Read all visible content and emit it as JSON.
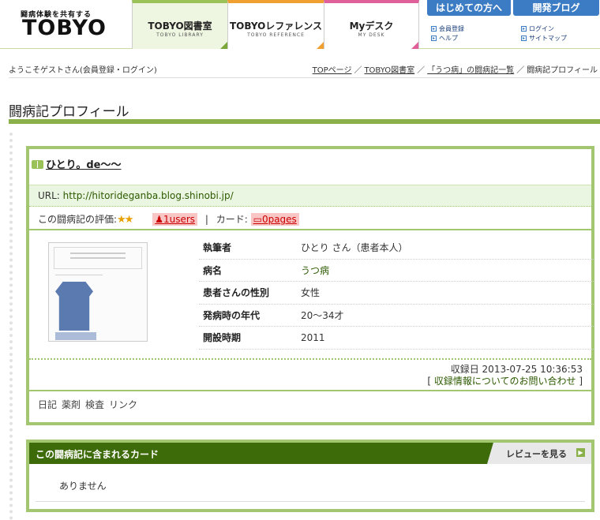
{
  "header": {
    "logo_tagline": "闘病体験を共有する",
    "logo_text": "TOBYO",
    "tabs": [
      {
        "label": "TOBYO図書室",
        "sublabel": "TOBYO LIBRARY"
      },
      {
        "label": "TOBYOレファレンス",
        "sublabel": "TOBYO REFERENCE"
      },
      {
        "label": "Myデスク",
        "sublabel": "MY DESK"
      }
    ],
    "btn_first": "はじめての方へ",
    "btn_blog": "開発ブログ",
    "sublinks": [
      "会員登録",
      "ヘルプ",
      "ログイン",
      "サイトマップ"
    ]
  },
  "welcome": {
    "prefix": "ようこそゲストさん(",
    "link": "会員登録・ログイン",
    "suffix": ")"
  },
  "breadcrumb": [
    "TOPページ",
    "TOBYO図書室",
    "「うつ病」の闘病記一覧",
    "闘病記プロフィール"
  ],
  "page_title": "闘病記プロフィール",
  "profile": {
    "title": "ひとり。de〜〜",
    "url_label": "URL: ",
    "url": "http://hitorideganba.blog.shinobi.jp/",
    "rating_label": "この闘病記の評価:",
    "stars": "★★",
    "users": "1users",
    "card_label": "カード:",
    "pages": "0pages",
    "info": [
      {
        "key": "執筆者",
        "value": "ひとり さん（患者本人）"
      },
      {
        "key": "病名",
        "value": "うつ病"
      },
      {
        "key": "患者さんの性別",
        "value": "女性"
      },
      {
        "key": "発病時の年代",
        "value": "20〜34才"
      },
      {
        "key": "開設時期",
        "value": "2011"
      }
    ],
    "reg_date": "収録日 2013-07-25 10:36:53",
    "reg_contact": "収録情報についてのお問い合わせ",
    "tabs": [
      "日記",
      "薬剤",
      "検査",
      "リンク"
    ]
  },
  "cards": {
    "header": "この闘病記に含まれるカード",
    "review_btn": "レビューを見る",
    "empty": "ありません"
  },
  "colors": {
    "accent_green": "#8ab04a",
    "dark_green": "#3e6b0a",
    "blue": "#3c7cc4"
  }
}
